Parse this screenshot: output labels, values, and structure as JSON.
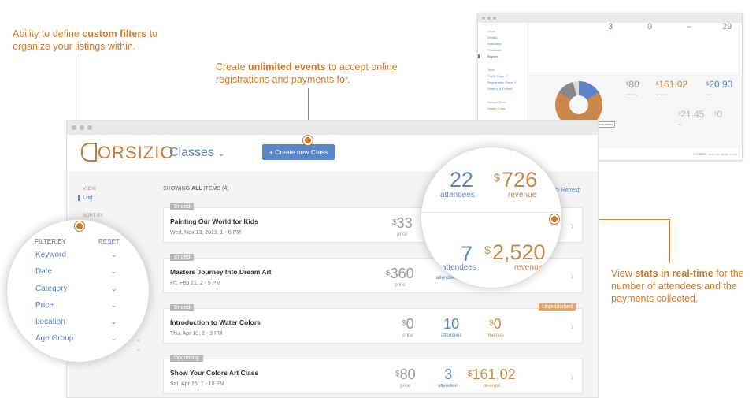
{
  "callouts": {
    "filters": {
      "lead": "Ability to define ",
      "em": "custom filters",
      "tail": " to organize your listings within."
    },
    "events": {
      "lead": "Create ",
      "em": "unlimited events",
      "tail": " to accept online registrations and payments for."
    },
    "stats": {
      "lead": "View ",
      "em": "stats in real-time",
      "tail": " for the number of attendees and the payments collected."
    }
  },
  "colors": {
    "accent": "#d07a2c",
    "link": "#5b85c8",
    "money": "#c9884a"
  },
  "header": {
    "logo_text": "ORSIZIO",
    "nav_label": "Classes",
    "nav_icon": "chevron-down-icon",
    "create_button": "+ Create new Class"
  },
  "sidebar": {
    "view_label": "VIEW",
    "list_label": "List",
    "sort_label": "SORT BY"
  },
  "listing": {
    "showing_prefix": "SHOWING ",
    "showing_bold": "ALL",
    "showing_suffix": " ITEMS (4)",
    "refresh_label": "Refresh"
  },
  "classes": [
    {
      "status": "Ended",
      "title": "Painting Our World for Kids",
      "date": "Wed, Nov 13, 2013, 1 - 6 PM",
      "price": "33",
      "price_label": "price"
    },
    {
      "status": "Ended",
      "title": "Masters Journey Into Dream Art",
      "date": "Fri, Feb 21, 2 - 5 PM",
      "price": "360",
      "price_label": "price",
      "attendees_label": "attendees"
    },
    {
      "status": "Ended",
      "title": "Introduction to Water Colors",
      "date": "Thu, Apr 10, 2 - 3 PM",
      "price": "0",
      "price_label": "price",
      "attendees": "10",
      "attendees_label": "attendees",
      "revenue": "0",
      "revenue_label": "revenue",
      "flag": "Unpublished"
    },
    {
      "status": "Upcoming",
      "title": "Show Your Colors Art Class",
      "date": "Sat, Apr 26, 7 - 10 PM",
      "price": "80",
      "price_label": "price",
      "attendees": "3",
      "attendees_label": "attendees",
      "revenue": "161.02",
      "revenue_label": "revenue"
    }
  ],
  "filter_zoom": {
    "header": "FILTER BY",
    "reset": "RESET",
    "items": [
      "Keyword",
      "Date",
      "Category",
      "Price",
      "Location",
      "Age Group"
    ]
  },
  "stats_zoom": {
    "top": {
      "attendees": "22",
      "attendees_label": "attendees",
      "revenue": "726",
      "revenue_label": "revenue"
    },
    "bottom": {
      "attendees": "7",
      "attendees_label": "attendees",
      "revenue": "2,520",
      "revenue_label": "revenue"
    }
  },
  "report": {
    "sidebar": {
      "level_label": "Level",
      "items": [
        "Details",
        "Attendees",
        "Feedback",
        "Report"
      ],
      "tools_label": "Tools",
      "tools": [
        "Public Page ↗",
        "Registration Form ↗",
        "Sharing & Embed"
      ],
      "danger_label": "Danger Zone",
      "delete": "Delete Class"
    },
    "top_stats": [
      "3",
      "0",
      "–",
      "29"
    ],
    "mid_stats": [
      {
        "value": "80",
        "label": "ticket price"
      },
      {
        "value": "161.02",
        "label": "net revenue"
      },
      {
        "value": "20.93",
        "label": "fees"
      }
    ],
    "low_stats": [
      {
        "value": "21.45",
        "label": "tax"
      },
      {
        "value": "0",
        "label": ""
      }
    ],
    "tooltip": "Net revenue\n$95.00 (58.8%)",
    "footer_logo": "CORSIZIO",
    "footer_text": "Hello and upload on our"
  }
}
